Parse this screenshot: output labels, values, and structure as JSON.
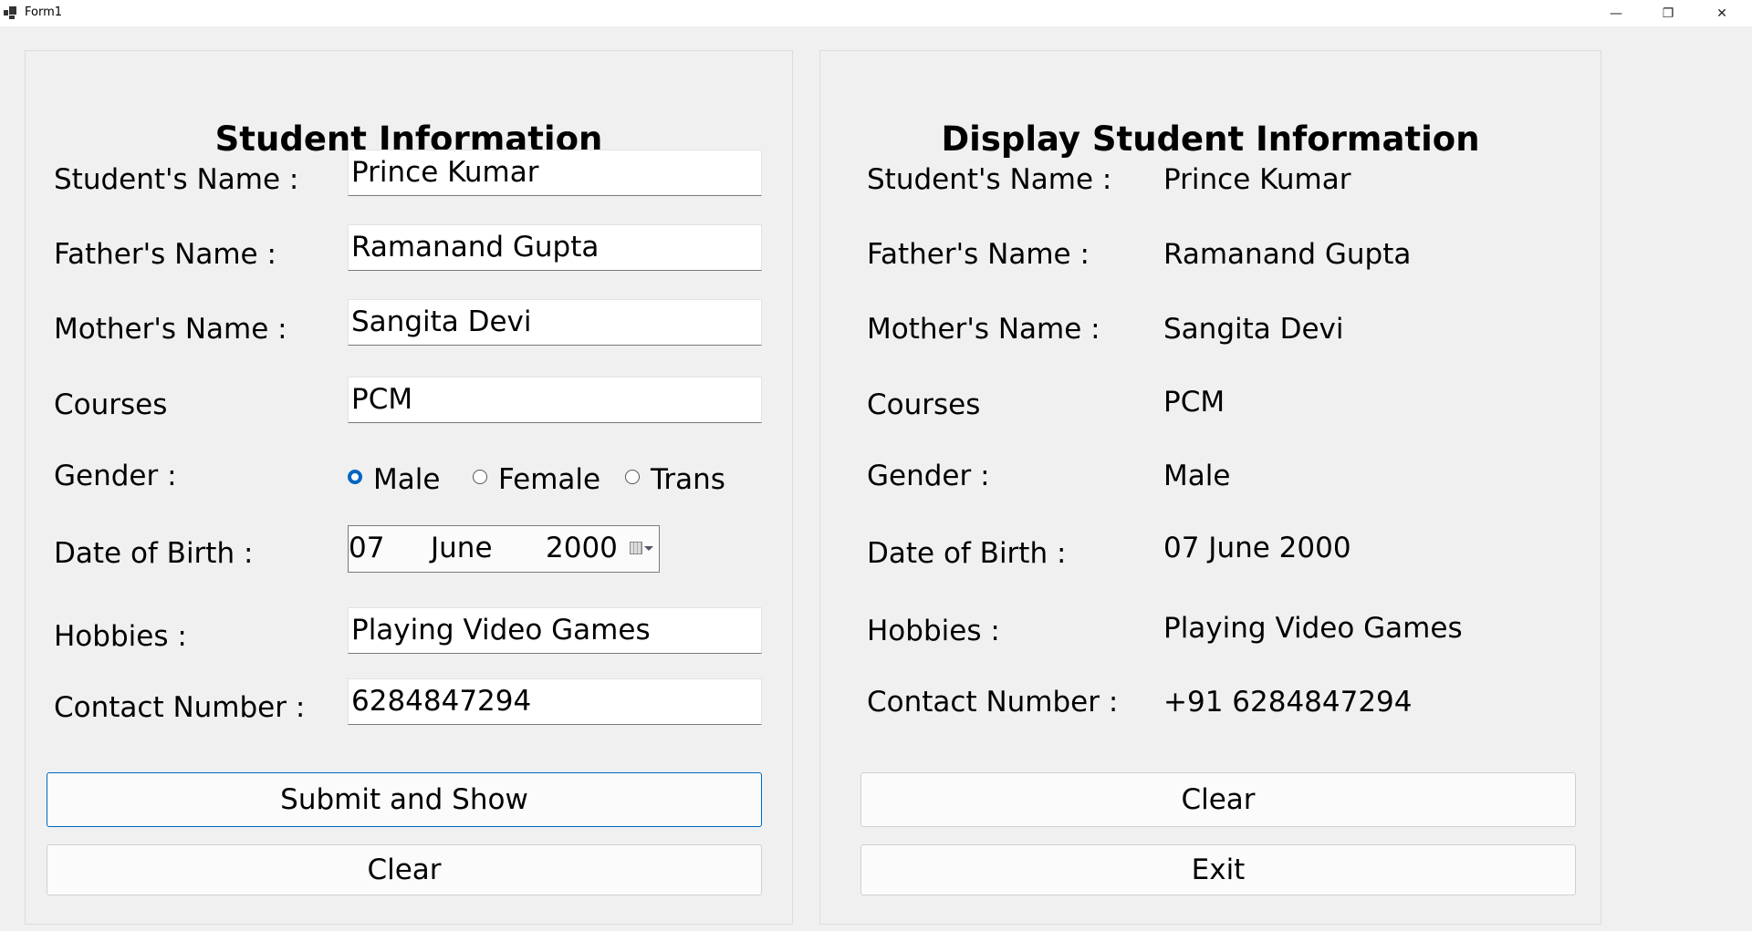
{
  "window": {
    "title": "Form1",
    "controls": {
      "minimize": "—",
      "restore": "❐",
      "close": "✕"
    }
  },
  "left": {
    "title": "Student Information",
    "labels": [
      "Student's Name :",
      "Father's Name :",
      "Mother's Name :",
      "Courses",
      "Gender :",
      "Date of Birth :",
      "Hobbies :",
      "Contact Number :"
    ],
    "student_name": "Prince Kumar",
    "father_name": "Ramanand Gupta",
    "mother_name": "Sangita Devi",
    "courses": "PCM",
    "gender_options": [
      "Male",
      "Female",
      "Trans"
    ],
    "gender_selected": "Male",
    "dob": {
      "day": "07",
      "month": "June",
      "year": "2000"
    },
    "hobbies": "Playing Video Games",
    "contact": "6284847294",
    "submit_label": "Submit and Show",
    "clear_label": "Clear"
  },
  "right": {
    "title": "Display Student Information",
    "labels": [
      "Student's Name :",
      "Father's Name :",
      "Mother's Name :",
      "Courses",
      "Gender :",
      "Date of Birth :",
      "Hobbies :",
      "Contact Number :"
    ],
    "values": [
      "Prince Kumar",
      "Ramanand Gupta",
      "Sangita Devi",
      "PCM",
      "Male",
      "07 June 2000",
      "Playing Video Games",
      "+91 6284847294"
    ],
    "clear_label": "Clear",
    "exit_label": "Exit"
  }
}
